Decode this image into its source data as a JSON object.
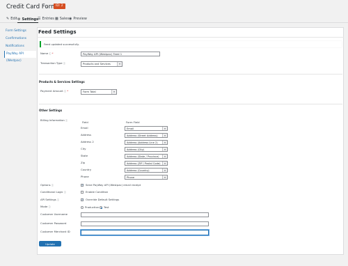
{
  "header": {
    "title": "Credit Card Form",
    "form_id": "ID: 2"
  },
  "tabs": [
    {
      "label": "Edit",
      "icon": "pencil-icon"
    },
    {
      "label": "Settings",
      "icon": "gear-icon"
    },
    {
      "label": "Entries",
      "icon": "list-icon"
    },
    {
      "label": "Sales",
      "icon": "chart-icon"
    },
    {
      "label": "Preview",
      "icon": "eye-icon"
    }
  ],
  "nav": [
    "Form Settings",
    "Confirmations",
    "Notifications",
    "PayWay API (Westpac)"
  ],
  "panel": {
    "title": "Feed Settings",
    "notice": "Feed updated successfully.",
    "name_label": "Name",
    "name_value": "PayWay API (Westpac) Feed 1",
    "transaction_label": "Transaction Type",
    "transaction_value": "Products and Services",
    "products_section": "Products & Services Settings",
    "payment_label": "Payment Amount",
    "payment_value": "Form Total",
    "other_section": "Other Settings",
    "billing_label": "Billing Information",
    "billing_col_field": "Field",
    "billing_col_form": "Form Field",
    "billing_rows": [
      {
        "field": "Email",
        "value": "Email"
      },
      {
        "field": "Address",
        "value": "Address (Street Address)"
      },
      {
        "field": "Address 2",
        "value": "Address (Address Line 2)"
      },
      {
        "field": "City",
        "value": "Address (City)"
      },
      {
        "field": "State",
        "value": "Address (State / Province)"
      },
      {
        "field": "Zip",
        "value": "Address (ZIP / Postal Code)"
      },
      {
        "field": "Country",
        "value": "Address (Country)"
      },
      {
        "field": "Phone",
        "value": "Phone"
      }
    ],
    "options_label": "Options",
    "options_text": "Send PayWay API (Westpac) email receipt",
    "conditional_label": "Conditional Logic",
    "conditional_text": "Enable Condition",
    "api_label": "API Settings",
    "api_text": "Override Default Settings",
    "mode_label": "Mode",
    "mode_production": "Production",
    "mode_test": "Test",
    "username_label": "Customer Username",
    "password_label": "Customer Password",
    "merchant_label": "Customer Merchant ID",
    "update_button": "Update Settings"
  }
}
